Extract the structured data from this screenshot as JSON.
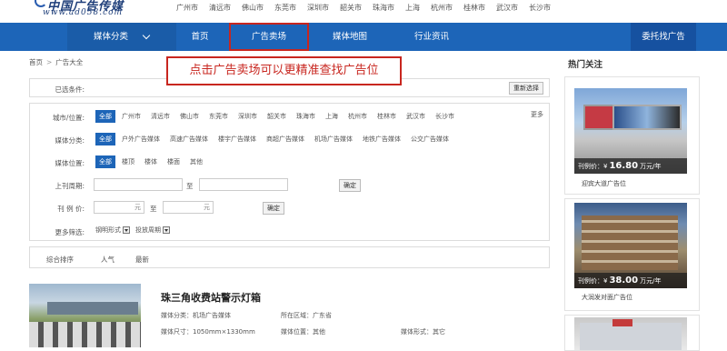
{
  "logo": {
    "brand": "中国广告传媒",
    "url": "www.ad058.com"
  },
  "cities": [
    "广州市",
    "清远市",
    "佛山市",
    "东莞市",
    "深圳市",
    "韶关市",
    "珠海市",
    "上海",
    "杭州市",
    "桂林市",
    "武汉市",
    "长沙市"
  ],
  "nav": {
    "category": "媒体分类",
    "home": "首页",
    "market": "广告卖场",
    "map": "媒体地图",
    "news": "行业资讯",
    "trust": "委托找广告"
  },
  "breadcrumb": {
    "home": "首页",
    "sep": ">",
    "current": "广告大全"
  },
  "callout": "点击广告卖场可以更精准查找广告位",
  "filter": {
    "selected_label": "已选条件:",
    "reset_label": "重新选择",
    "city_label": "城市/位置:",
    "city_options": [
      "全部",
      "广州市",
      "清远市",
      "佛山市",
      "东莞市",
      "深圳市",
      "韶关市",
      "珠海市",
      "上海",
      "杭州市",
      "桂林市",
      "武汉市",
      "长沙市"
    ],
    "more_label": "更多",
    "media_type_label": "媒体分类:",
    "media_type_options": [
      "全部",
      "户外广告媒体",
      "高速广告媒体",
      "楼宇广告媒体",
      "商超广告媒体",
      "机场广告媒体",
      "地铁广告媒体",
      "公交广告媒体"
    ],
    "position_label": "媒体位置:",
    "position_options": [
      "全部",
      "楼顶",
      "楼体",
      "楼面",
      "其他"
    ],
    "period_label": "上刊周期:",
    "to": "至",
    "confirm": "确定",
    "price_label": "刊 例 价:",
    "price_unit": "元",
    "more_filter_label": "更多筛选:",
    "select_1": "钢明形式",
    "select_2": "投放周期"
  },
  "sort": {
    "label": "综合排序",
    "popular": "人气",
    "newest": "最新"
  },
  "listing": {
    "title": "珠三角收费站警示灯箱",
    "category": "媒体分类：机场广告媒体",
    "region": "所在区域：广东省",
    "size": "媒体尺寸：1050mm×1330mm",
    "position": "媒体位置：其他",
    "form": "媒体形式：其它"
  },
  "hot": {
    "title": "热门关注",
    "items": [
      {
        "price_label": "刊例价：¥",
        "price": "16.80",
        "unit": "万元/年",
        "name": "迎宾大道广告位"
      },
      {
        "price_label": "刊例价：¥",
        "price": "38.00",
        "unit": "万元/年",
        "name": "大润发对面广告位"
      }
    ]
  }
}
